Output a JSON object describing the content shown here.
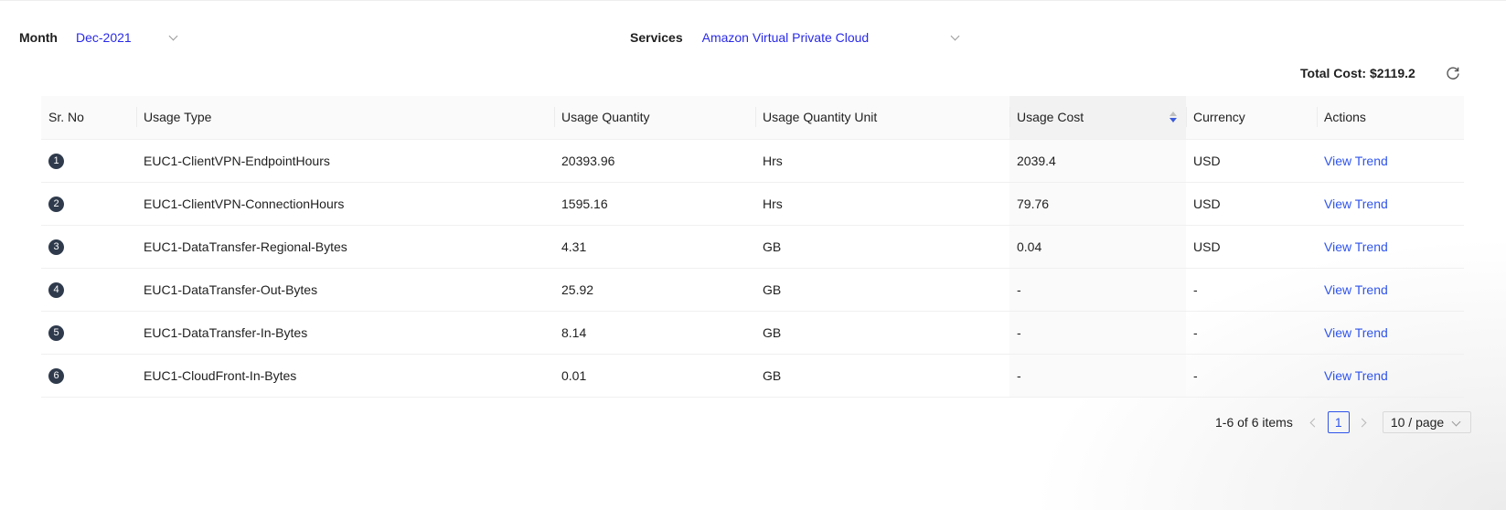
{
  "filters": {
    "month": {
      "label": "Month",
      "value": "Dec-2021"
    },
    "services": {
      "label": "Services",
      "value": "Amazon Virtual Private Cloud"
    }
  },
  "summary": {
    "total_cost": "Total Cost: $2119.2"
  },
  "table": {
    "columns": [
      "Sr. No",
      "Usage Type",
      "Usage Quantity",
      "Usage Quantity Unit",
      "Usage Cost",
      "Currency",
      "Actions"
    ],
    "sorted_column": "Usage Cost",
    "rows": [
      {
        "sr": "1",
        "usage_type": "EUC1-ClientVPN-EndpointHours",
        "quantity": "20393.96",
        "unit": "Hrs",
        "cost": "2039.4",
        "currency": "USD",
        "action": "View Trend"
      },
      {
        "sr": "2",
        "usage_type": "EUC1-ClientVPN-ConnectionHours",
        "quantity": "1595.16",
        "unit": "Hrs",
        "cost": "79.76",
        "currency": "USD",
        "action": "View Trend"
      },
      {
        "sr": "3",
        "usage_type": "EUC1-DataTransfer-Regional-Bytes",
        "quantity": "4.31",
        "unit": "GB",
        "cost": "0.04",
        "currency": "USD",
        "action": "View Trend"
      },
      {
        "sr": "4",
        "usage_type": "EUC1-DataTransfer-Out-Bytes",
        "quantity": "25.92",
        "unit": "GB",
        "cost": "-",
        "currency": "-",
        "action": "View Trend"
      },
      {
        "sr": "5",
        "usage_type": "EUC1-DataTransfer-In-Bytes",
        "quantity": "8.14",
        "unit": "GB",
        "cost": "-",
        "currency": "-",
        "action": "View Trend"
      },
      {
        "sr": "6",
        "usage_type": "EUC1-CloudFront-In-Bytes",
        "quantity": "0.01",
        "unit": "GB",
        "cost": "-",
        "currency": "-",
        "action": "View Trend"
      }
    ]
  },
  "pagination": {
    "range": "1-6 of 6 items",
    "current_page": "1",
    "page_size": "10 / page"
  },
  "icons": {
    "refresh": "refresh-icon",
    "dropdown": "chevron-down-icon",
    "sort": "sort-icon"
  },
  "colors": {
    "link": "#2f54eb",
    "filter_value": "#2a2ae8",
    "badge": "#2f3b4c"
  }
}
